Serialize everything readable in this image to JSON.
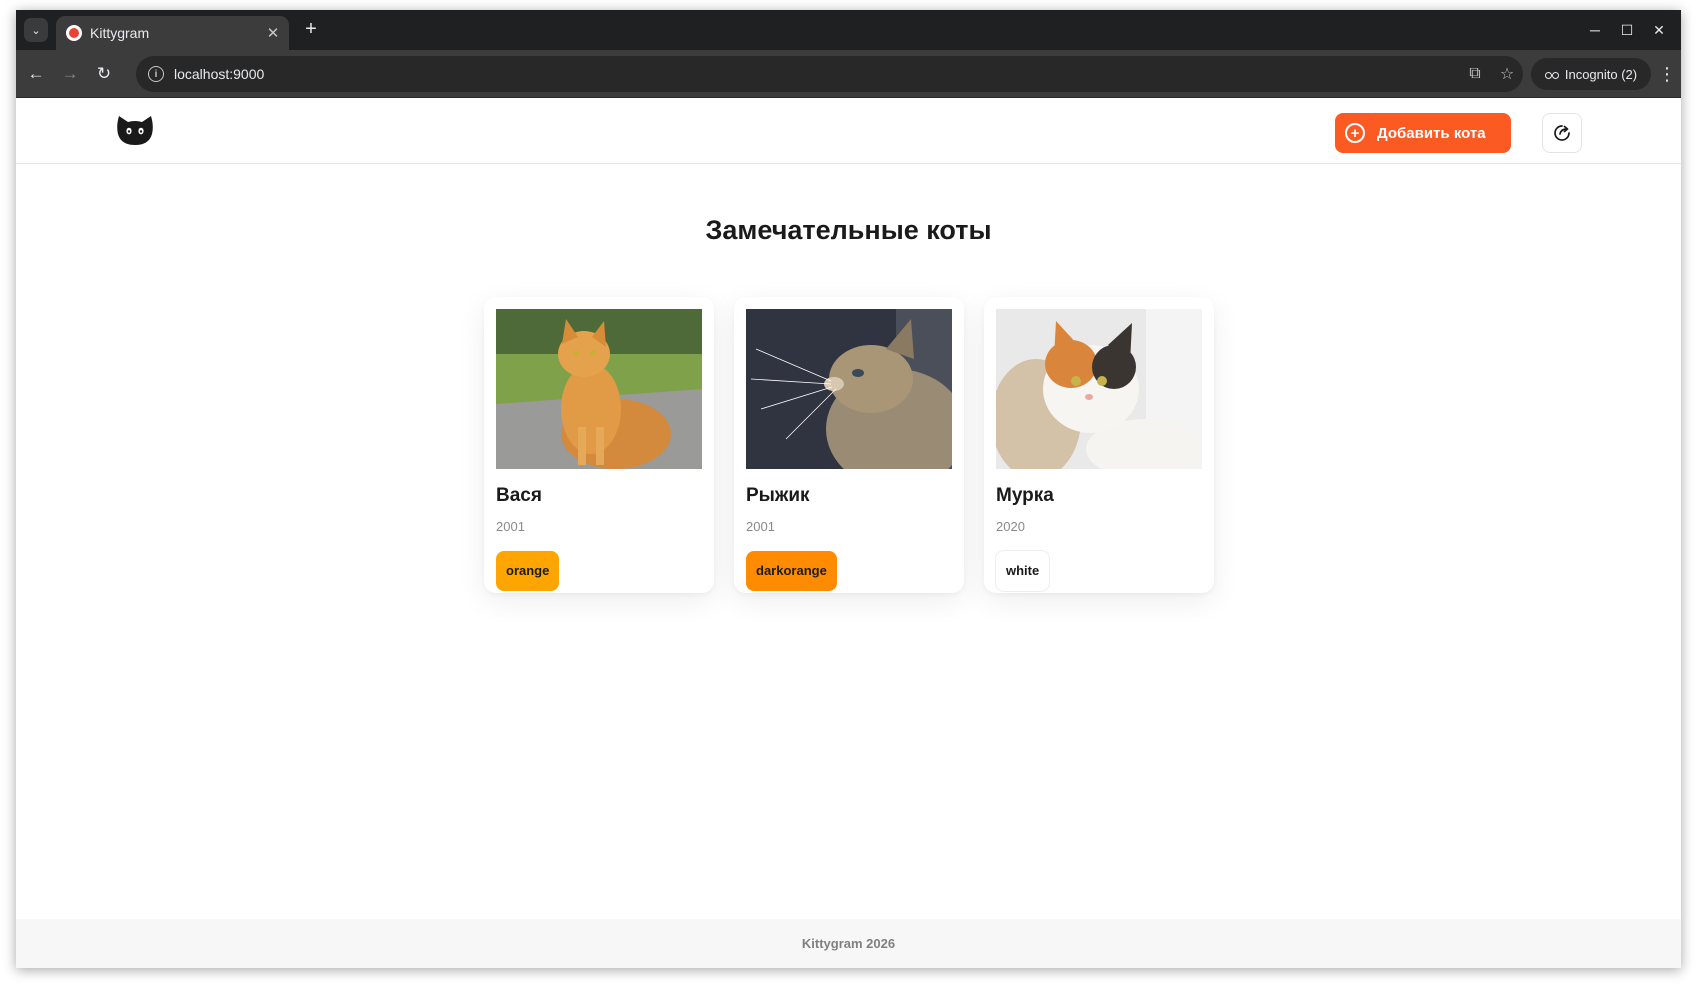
{
  "browser": {
    "tab_title": "Kittygram",
    "url": "localhost:9000",
    "incognito_label": "Incognito (2)"
  },
  "header": {
    "add_cat_label": "Добавить кота"
  },
  "main": {
    "title": "Замечательные коты",
    "cats": [
      {
        "name": "Вася",
        "year": "2001",
        "color": "orange",
        "color_hex": "#ffa500"
      },
      {
        "name": "Рыжик",
        "year": "2001",
        "color": "darkorange",
        "color_hex": "#ff8c00"
      },
      {
        "name": "Мурка",
        "year": "2020",
        "color": "white",
        "color_hex": "#ffffff"
      }
    ]
  },
  "footer": {
    "text": "Kittygram 2026"
  },
  "colors": {
    "accent": "#fb5a23",
    "tabstrip": "#1f2021",
    "toolbar": "#3c3c3c"
  }
}
